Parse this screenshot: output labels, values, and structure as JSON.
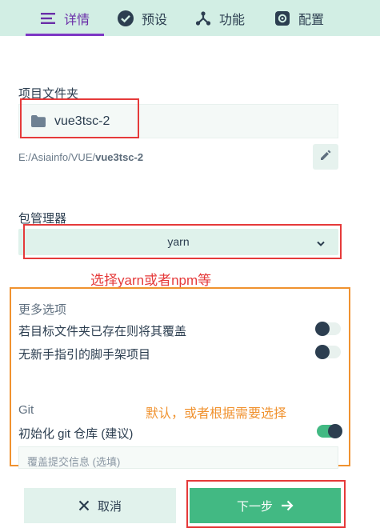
{
  "tabs": [
    {
      "label": "详情",
      "icon": "list-icon",
      "active": true
    },
    {
      "label": "预设",
      "icon": "check-circle-icon",
      "active": false
    },
    {
      "label": "功能",
      "icon": "branch-icon",
      "active": false
    },
    {
      "label": "配置",
      "icon": "gear-icon",
      "active": false
    }
  ],
  "folder": {
    "section_label": "项目文件夹",
    "name": "vue3tsc-2",
    "path_prefix": "E:/Asiainfo/VUE/",
    "path_name": "vue3tsc-2"
  },
  "package_manager": {
    "section_label": "包管理器",
    "selected": "yarn"
  },
  "annotations": {
    "select_note": "选择yarn或者npm等",
    "default_note": "默认，或者根据需要选择"
  },
  "more_options": {
    "section_label": "更多选项",
    "overwrite_label": "若目标文件夹已存在则将其覆盖",
    "overwrite_on": false,
    "no_guide_label": "无新手指引的脚手架项目",
    "no_guide_on": false
  },
  "git": {
    "section_label": "Git",
    "init_label": "初始化 git 仓库 (建议)",
    "init_on": true,
    "commit_placeholder": "覆盖提交信息 (选填)"
  },
  "actions": {
    "cancel_label": "取消",
    "next_label": "下一步"
  },
  "colors": {
    "accent": "#42b983",
    "tab_active": "#7d37c4",
    "annotation_red": "#e53a3a",
    "annotation_orange": "#f0922f"
  }
}
